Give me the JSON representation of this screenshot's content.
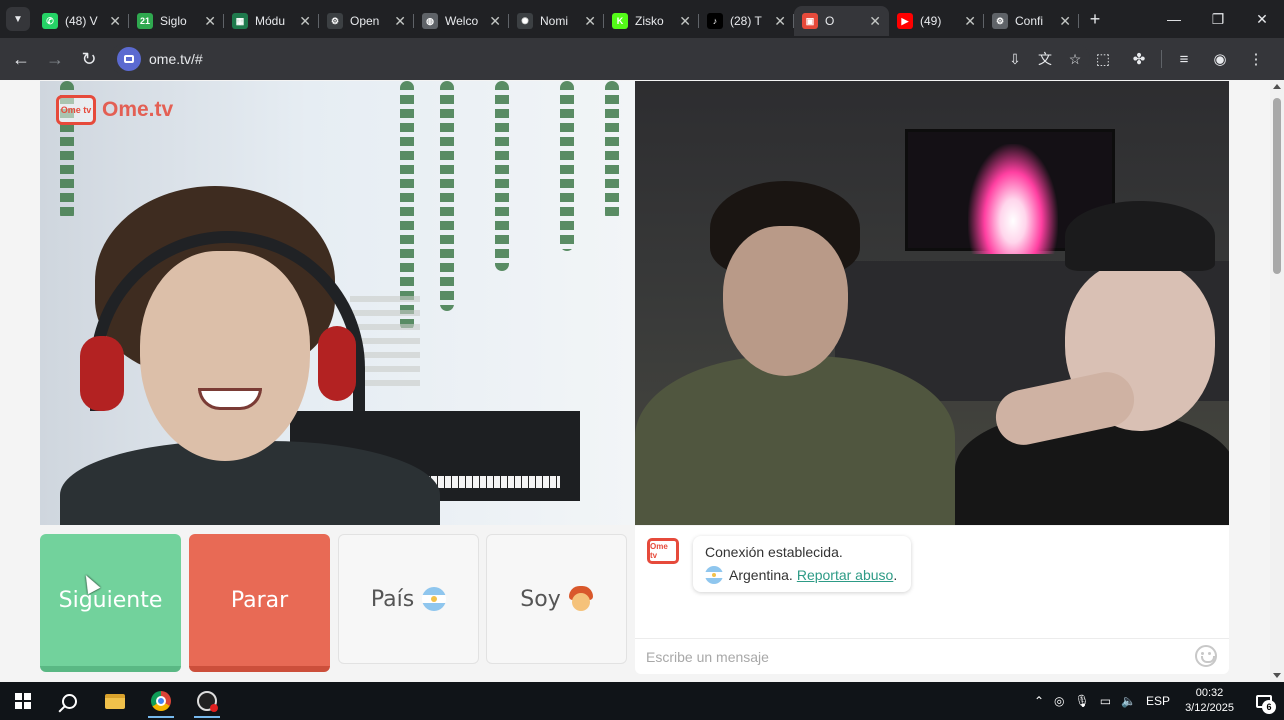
{
  "browser": {
    "tabs": [
      {
        "title": "(48) V",
        "icon": "whatsapp-icon",
        "color": "#25d366",
        "glyph": "✆",
        "active": false
      },
      {
        "title": "Siglo",
        "icon": "siglo21-icon",
        "color": "#2fa84f",
        "glyph": "21",
        "active": false
      },
      {
        "title": "Módu",
        "icon": "module-icon",
        "color": "#1f7a4d",
        "glyph": "▦",
        "active": false
      },
      {
        "title": "Open",
        "icon": "openai-icon",
        "color": "#3c4043",
        "glyph": "⚙",
        "active": false
      },
      {
        "title": "Welco",
        "icon": "globe-icon",
        "color": "#5f6368",
        "glyph": "◍",
        "active": false
      },
      {
        "title": "Nomi",
        "icon": "openai-icon",
        "color": "#3c4043",
        "glyph": "✺",
        "active": false
      },
      {
        "title": "Zisko",
        "icon": "kick-icon",
        "color": "#53fc18",
        "glyph": "K",
        "active": false
      },
      {
        "title": "(28) T",
        "icon": "tiktok-icon",
        "color": "#000000",
        "glyph": "♪",
        "active": false
      },
      {
        "title": "O",
        "icon": "ometv-icon",
        "color": "#e64a3b",
        "glyph": "▣",
        "active": true
      },
      {
        "title": "(49)",
        "icon": "youtube-icon",
        "color": "#ff0000",
        "glyph": "▶",
        "active": false
      },
      {
        "title": "Confi",
        "icon": "settings-icon",
        "color": "#5f6368",
        "glyph": "⚙",
        "active": false
      }
    ],
    "url": "ome.tv/#"
  },
  "page": {
    "logo_text": "Ome.tv",
    "logo_badge": "Ome tv",
    "buttons": {
      "next": "Siguiente",
      "stop": "Parar",
      "country": "País",
      "soy": "Soy"
    },
    "chat": {
      "badge": "Ome tv",
      "status": "Conexión establecida.",
      "country": "Argentina.",
      "report": "Reportar abuso",
      "report_suffix": ".",
      "placeholder": "Escribe un mensaje"
    }
  },
  "taskbar": {
    "language": "ESP",
    "time": "00:32",
    "date": "3/12/2025",
    "notifications": "6"
  },
  "colors": {
    "next_button": "#72d29c",
    "stop_button": "#e86a55",
    "brand": "#e64a3b",
    "link": "#2d9b86"
  }
}
